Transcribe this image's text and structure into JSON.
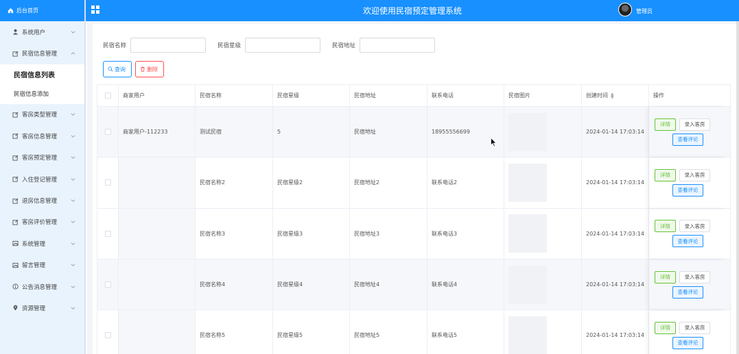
{
  "sidebar": {
    "home": "后台首页",
    "items": [
      {
        "label": "系统用户",
        "icon": "user-icon"
      },
      {
        "label": "民宿信息管理",
        "icon": "edit-icon",
        "expanded": true
      },
      {
        "label": "客房类型管理",
        "icon": "edit-icon"
      },
      {
        "label": "客房信息管理",
        "icon": "edit-icon"
      },
      {
        "label": "客房预定管理",
        "icon": "edit-icon"
      },
      {
        "label": "入住登记管理",
        "icon": "edit-icon"
      },
      {
        "label": "退房信息管理",
        "icon": "edit-icon"
      },
      {
        "label": "客房评价管理",
        "icon": "edit-icon"
      },
      {
        "label": "系统管理",
        "icon": "image-icon"
      },
      {
        "label": "留言管理",
        "icon": "image-icon"
      },
      {
        "label": "公告消息管理",
        "icon": "info-icon"
      },
      {
        "label": "资源管理",
        "icon": "location-icon"
      }
    ],
    "subitems": [
      "民宿信息列表",
      "民宿信息添加"
    ]
  },
  "header": {
    "title": "欢迎使用民宿预定管理系统",
    "user": "管理员"
  },
  "search": {
    "fields": [
      "民宿名称",
      "民宿星级",
      "民宿地址"
    ],
    "query_button": "查询",
    "delete_button": "删除"
  },
  "table": {
    "headers": [
      "商家用户",
      "民宿名称",
      "民宿星级",
      "民宿地址",
      "联系电话",
      "民宿图片",
      "创建时间",
      "操作"
    ],
    "rows": [
      {
        "merchant": "商家用户-112233",
        "name": "测试民宿",
        "star": "5",
        "address": "民宿地址",
        "phone": "18955556699",
        "created": "2024-01-14 17:03:14"
      },
      {
        "merchant": "",
        "name": "民宿名称2",
        "star": "民宿星级2",
        "address": "民宿地址2",
        "phone": "联系电话2",
        "created": "2024-01-14 17:03:14"
      },
      {
        "merchant": "",
        "name": "民宿名称3",
        "star": "民宿星级3",
        "address": "民宿地址3",
        "phone": "联系电话3",
        "created": "2024-01-14 17:03:14"
      },
      {
        "merchant": "",
        "name": "民宿名称4",
        "star": "民宿星级4",
        "address": "民宿地址4",
        "phone": "联系电话4",
        "created": "2024-01-14 17:03:14"
      },
      {
        "merchant": "",
        "name": "民宿名称5",
        "star": "民宿星级5",
        "address": "民宿地址5",
        "phone": "联系电话5",
        "created": "2024-01-14 17:03:14"
      }
    ],
    "ops": {
      "detail": "详情",
      "enter_room": "录入客房",
      "view_reviews": "查看评论"
    }
  },
  "colors": {
    "primary": "#1890ff",
    "danger": "#ff4d4f",
    "success": "#67c23a"
  }
}
